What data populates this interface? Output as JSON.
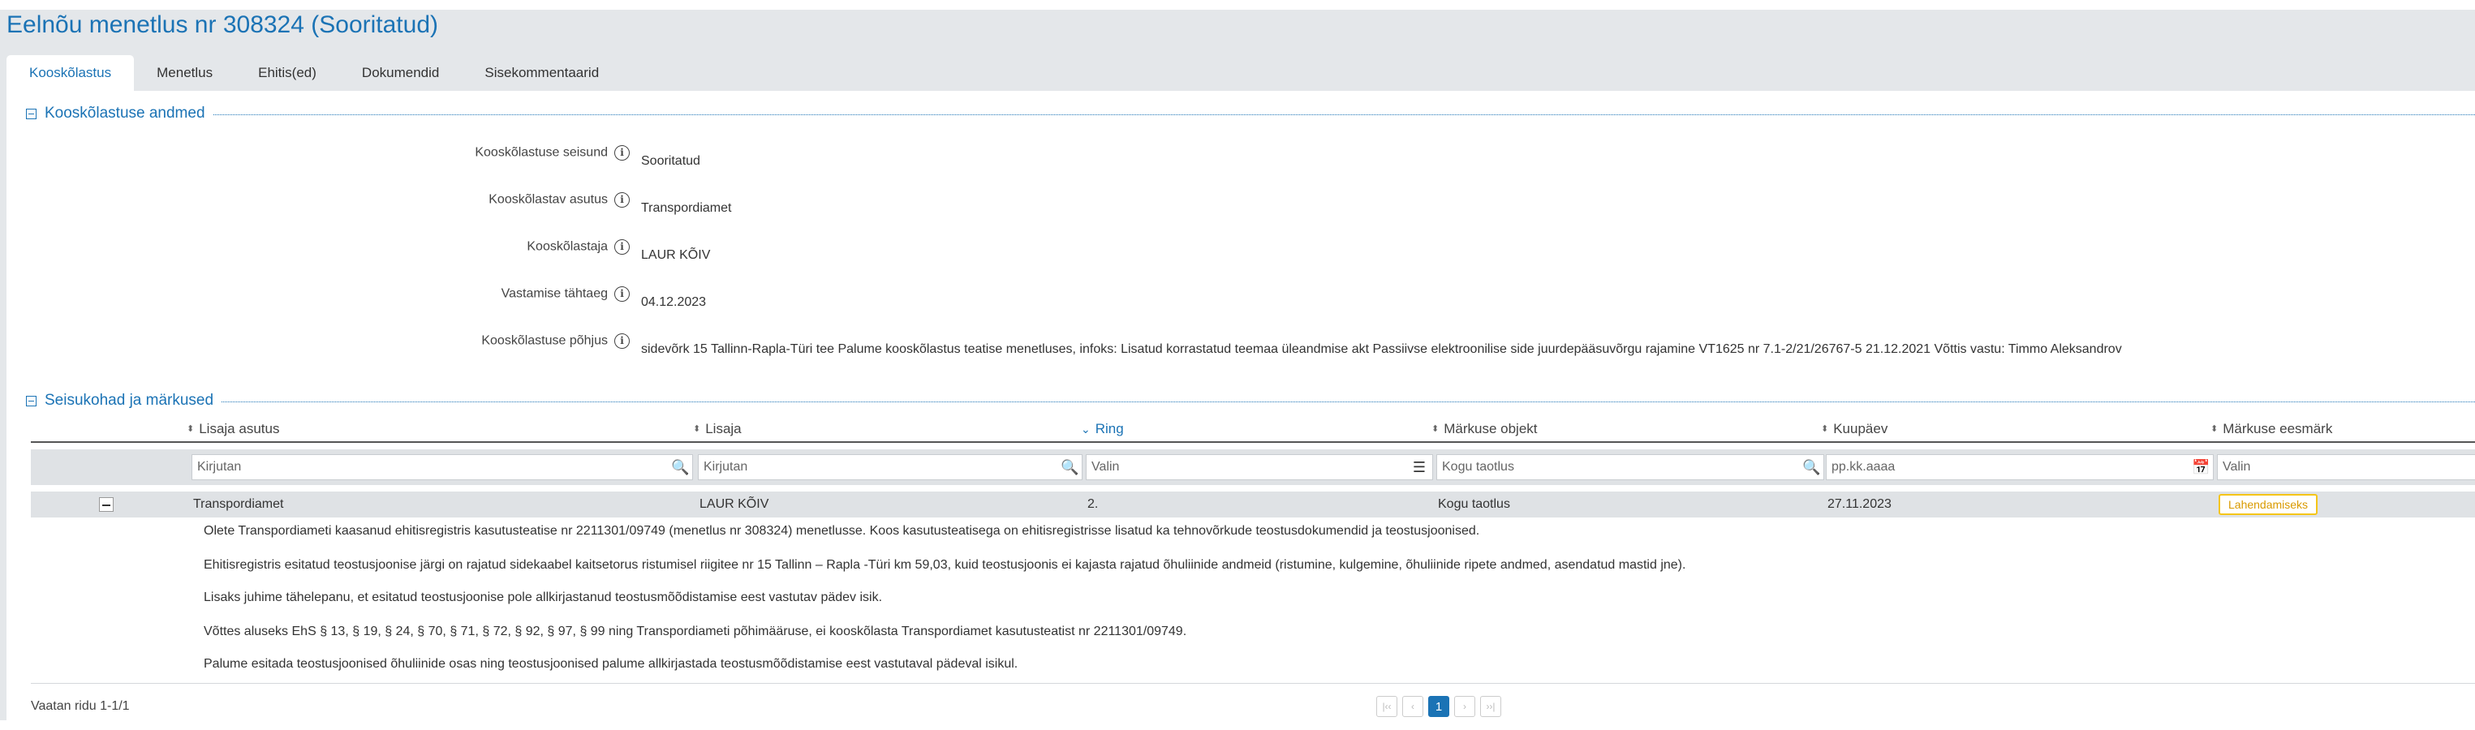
{
  "page": {
    "title": "Eelnõu menetlus nr 308324 (Sooritatud)"
  },
  "tabs": [
    {
      "label": "Kooskõlastus",
      "active": true
    },
    {
      "label": "Menetlus"
    },
    {
      "label": "Ehitis(ed)"
    },
    {
      "label": "Dokumendid"
    },
    {
      "label": "Sisekommentaarid"
    }
  ],
  "details": {
    "section_title": "Kooskõlastuse andmed",
    "fields": [
      {
        "label": "Kooskõlastuse seisund",
        "value": "Sooritatud"
      },
      {
        "label": "Kooskõlastav asutus",
        "value": "Transpordiamet"
      },
      {
        "label": "Kooskõlastaja",
        "value": "LAUR KÕIV"
      },
      {
        "label": "Vastamise tähtaeg",
        "value": "04.12.2023"
      },
      {
        "label": "Kooskõlastuse põhjus",
        "value": "sidevõrk 15 Tallinn-Rapla-Türi tee Palume kooskõlastus teatise menetluses, infoks: Lisatud korrastatud teemaa üleandmise akt Passiivse elektroonilise side juurdepääsuvõrgu rajamine VT1625 nr 7.1-2/21/26767-5 21.12.2021 Võttis vastu: Timmo Aleksandrov"
      }
    ],
    "info_icon": "info-icon"
  },
  "remarks": {
    "section_title": "Seisukohad ja märkused",
    "columns": [
      {
        "label": "Lisaja asutus",
        "filter_placeholder": "Kirjutan",
        "filter_icon": "🔍"
      },
      {
        "label": "Lisaja",
        "filter_placeholder": "Kirjutan",
        "filter_icon": "🔍"
      },
      {
        "label": "Ring",
        "filter_placeholder": "Valin",
        "filter_icon": "☰",
        "sorted": true
      },
      {
        "label": "Märkuse objekt",
        "filter_placeholder": "Kogu taotlus",
        "filter_icon": "🔍"
      },
      {
        "label": "Kuupäev",
        "filter_placeholder": "pp.kk.aaaa",
        "filter_icon": "📅"
      },
      {
        "label": "Märkuse eesmärk",
        "filter_placeholder": "Valin"
      }
    ],
    "row": {
      "asutus": "Transpordiamet",
      "lisaja": "LAUR KÕIV",
      "ring": "2.",
      "objekt": "Kogu taotlus",
      "kuupaev": "27.11.2023",
      "eesmark": "Lahendamiseks"
    },
    "paragraphs": [
      "Olete Transpordiameti kaasanud ehitisregistris kasutusteatise nr 2211301/09749 (menetlus nr 308324) menetlusse. Koos kasutusteatisega on ehitisregistrisse lisatud ka tehnovõrkude teostusdokumendid ja teostusjoonised.",
      "Ehitisregistris esitatud teostusjoonise järgi on rajatud sidekaabel kaitsetorus ristumisel riigitee nr 15 Tallinn – Rapla -Türi km 59,03, kuid teostusjoonis ei kajasta rajatud õhuliinide andmeid (ristumine, kulgemine, õhuliinide ripete andmed, asendatud mastid jne).",
      "Lisaks juhime tähelepanu, et esitatud teostusjoonise pole allkirjastanud teostusmõõdistamise eest vastutav pädev isik.",
      "Võttes aluseks EhS § 13, § 19, § 24, § 70, § 71, § 72, § 92, § 97, § 99 ning Transpordiameti põhimääruse, ei kooskõlasta Transpordiamet kasutusteatist nr 2211301/09749.",
      "Palume esitada teostusjoonised õhuliinide osas ning teostusjoonised palume allkirjastada teostusmõõdistamise eest vastutaval pädeval isikul."
    ]
  },
  "footer": {
    "row_count": "Vaatan ridu 1-1/1",
    "pager": {
      "first": "|‹‹",
      "prev": "‹",
      "current": "1",
      "next": "›",
      "last": "››|"
    }
  },
  "colors": {
    "accent": "#1b73b5",
    "badge_border": "#f5c518"
  }
}
